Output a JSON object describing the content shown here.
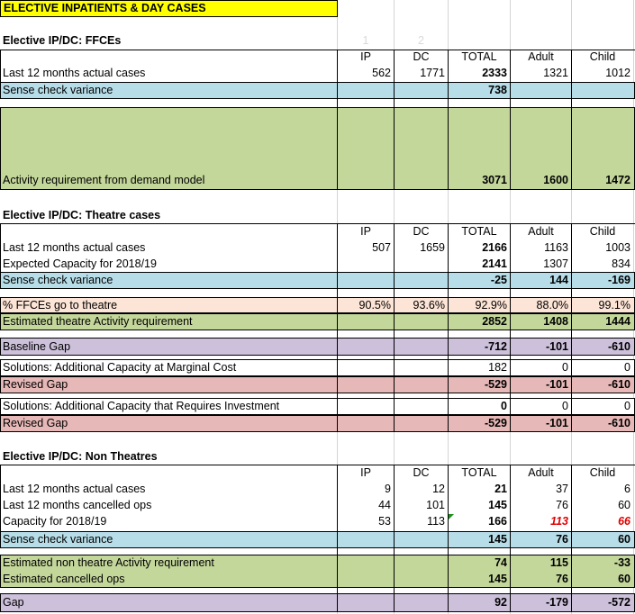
{
  "title": "ELECTIVE INPATIENTS & DAY CASES",
  "colors": {
    "title_bg": "#ffff00",
    "blue": "#b7dde8",
    "green": "#c4d79b",
    "peach": "#fce4d6",
    "purple": "#ccc0da",
    "pink": "#e6b8b7",
    "red_text": "#e00000"
  },
  "ffce": {
    "heading": "Elective IP/DC: FFCEs",
    "ghost1": "1",
    "ghost2": "2",
    "h_ip": "IP",
    "h_dc": "DC",
    "h_total": "TOTAL",
    "h_adult": "Adult",
    "h_child": "Child",
    "r1": {
      "label": "Last 12 months actual cases",
      "ip": "562",
      "dc": "1771",
      "total": "2333",
      "adult": "1321",
      "child": "1012"
    },
    "r2": {
      "label": "Sense check variance",
      "total": "738"
    },
    "r3": {
      "label": "Activity requirement from demand model",
      "total": "3071",
      "adult": "1600",
      "child": "1472"
    }
  },
  "theatre": {
    "heading": "Elective IP/DC: Theatre cases",
    "h_ip": "IP",
    "h_dc": "DC",
    "h_total": "TOTAL",
    "h_adult": "Adult",
    "h_child": "Child",
    "r1": {
      "label": "Last 12 months actual cases",
      "ip": "507",
      "dc": "1659",
      "total": "2166",
      "adult": "1163",
      "child": "1003"
    },
    "r2": {
      "label": "Expected Capacity for 2018/19",
      "total": "2141",
      "adult": "1307",
      "child": "834"
    },
    "r3": {
      "label": "Sense check variance",
      "total": "-25",
      "adult": "144",
      "child": "-169"
    },
    "r4": {
      "label": "% FFCEs go to theatre",
      "ip": "90.5%",
      "dc": "93.6%",
      "total": "92.9%",
      "adult": "88.0%",
      "child": "99.1%"
    },
    "r5": {
      "label": "Estimated theatre Activity requirement",
      "total": "2852",
      "adult": "1408",
      "child": "1444"
    },
    "r6": {
      "label": "Baseline Gap",
      "total": "-712",
      "adult": "-101",
      "child": "-610"
    },
    "r7": {
      "label": "Solutions: Additional Capacity at Marginal Cost",
      "total": "182",
      "adult": "0",
      "child": "0"
    },
    "r8": {
      "label": "Revised Gap",
      "total": "-529",
      "adult": "-101",
      "child": "-610"
    },
    "r9": {
      "label": "Solutions: Additional Capacity that Requires Investment",
      "total": "0",
      "adult": "0",
      "child": "0"
    },
    "r10": {
      "label": "Revised Gap",
      "total": "-529",
      "adult": "-101",
      "child": "-610"
    }
  },
  "nontheatre": {
    "heading": "Elective IP/DC: Non Theatres",
    "h_ip": "IP",
    "h_dc": "DC",
    "h_total": "TOTAL",
    "h_adult": "Adult",
    "h_child": "Child",
    "r1": {
      "label": "Last 12 months actual cases",
      "ip": "9",
      "dc": "12",
      "total": "21",
      "adult": "37",
      "child": "6"
    },
    "r2": {
      "label": "Last 12 months cancelled ops",
      "ip": "44",
      "dc": "101",
      "total": "145",
      "adult": "76",
      "child": "60"
    },
    "r3": {
      "label": "Capacity for 2018/19",
      "ip": "53",
      "dc": "113",
      "total": "166",
      "adult": "113",
      "child": "66"
    },
    "r4": {
      "label": "Sense check variance",
      "total": "145",
      "adult": "76",
      "child": "60"
    },
    "r5": {
      "label": "Estimated non theatre Activity requirement",
      "total": "74",
      "adult": "115",
      "child": "-33"
    },
    "r6": {
      "label": "Estimated cancelled ops",
      "total": "145",
      "adult": "76",
      "child": "60"
    },
    "r7": {
      "label": "Gap",
      "total": "92",
      "adult": "-179",
      "child": "-572"
    }
  }
}
